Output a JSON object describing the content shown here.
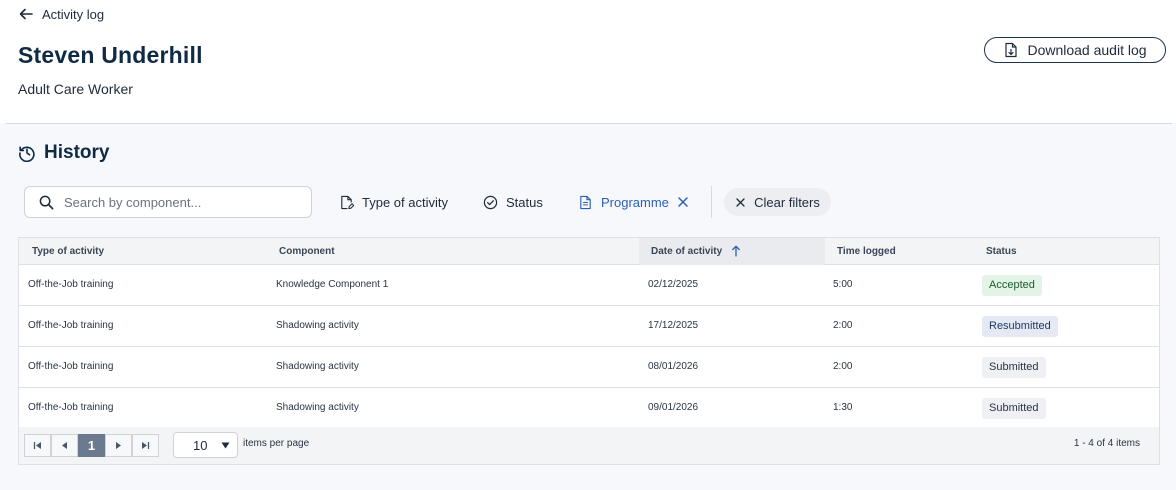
{
  "header": {
    "back_label": "Activity log",
    "person_name": "Steven Underhill",
    "person_role": "Adult Care Worker",
    "download_label": "Download audit log"
  },
  "history": {
    "title": "History",
    "search_placeholder": "Search by component...",
    "filters": {
      "type_label": "Type of activity",
      "status_label": "Status",
      "programme_label": "Programme",
      "clear_label": "Clear filters"
    }
  },
  "table": {
    "columns": [
      "Type of activity",
      "Component",
      "Date of activity",
      "Time logged",
      "Status"
    ],
    "sorted_column": "Date of activity",
    "rows": [
      {
        "type": "Off-the-Job training",
        "component": "Knowledge Component 1",
        "date": "02/12/2025",
        "time": "5:00",
        "status": "Accepted"
      },
      {
        "type": "Off-the-Job training",
        "component": "Shadowing activity",
        "date": "17/12/2025",
        "time": "2:00",
        "status": "Resubmitted"
      },
      {
        "type": "Off-the-Job training",
        "component": "Shadowing activity",
        "date": "08/01/2026",
        "time": "2:00",
        "status": "Submitted"
      },
      {
        "type": "Off-the-Job training",
        "component": "Shadowing activity",
        "date": "09/01/2026",
        "time": "1:30",
        "status": "Submitted"
      }
    ]
  },
  "pager": {
    "current_page": "1",
    "page_size": "10",
    "per_page_label": "items per page",
    "info": "1 - 4 of 4 items"
  },
  "colors": {
    "heading": "#0f2a44",
    "accent": "#2b5fb3",
    "accepted_bg": "#e3f4e6",
    "resubmitted_bg": "#e4e9f4",
    "submitted_bg": "#eef0f3"
  },
  "icons": {
    "back": "arrow-left-icon",
    "download": "file-download-icon",
    "history": "clock-history-icon",
    "search": "search-icon",
    "type": "file-edit-icon",
    "status": "check-circle-icon",
    "programme": "document-icon",
    "close": "close-icon",
    "sort": "arrow-up-icon"
  }
}
